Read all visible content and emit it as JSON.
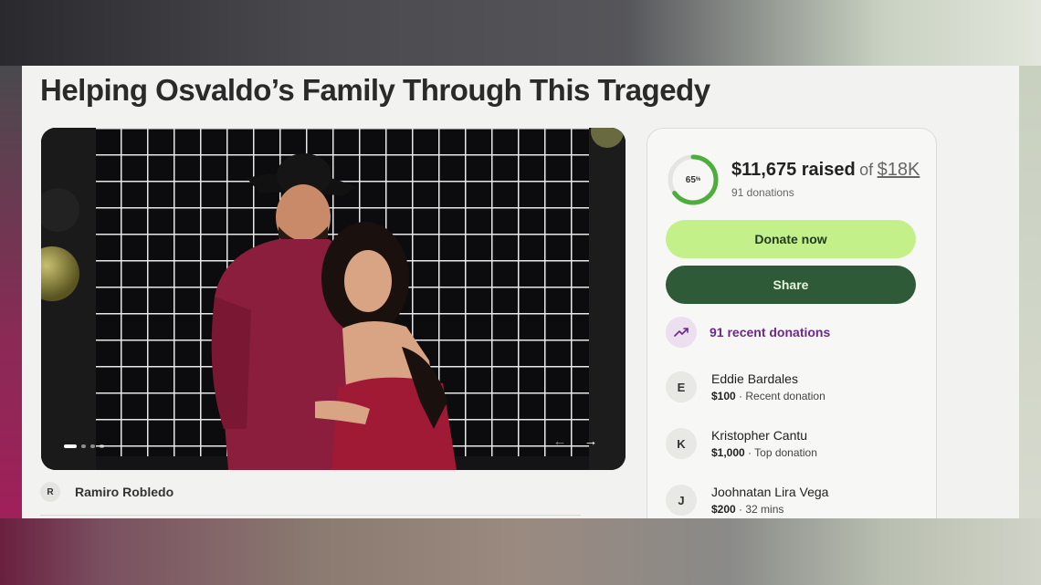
{
  "page": {
    "title": "Helping Osvaldo’s Family Through This Tragedy"
  },
  "gallery": {
    "prev_icon": "arrow-left-icon",
    "next_icon": "arrow-right-icon",
    "prev_glyph": "←",
    "next_glyph": "→"
  },
  "organizer": {
    "initial": "R",
    "name": "Ramiro Robledo"
  },
  "fundraiser": {
    "percent": 65,
    "percent_label": "65",
    "percent_suffix": "%",
    "raised": "$11,675 raised",
    "of": "of",
    "goal": "$18K",
    "donations": "91 donations",
    "accent_color": "#4caf3c"
  },
  "actions": {
    "donate": "Donate now",
    "share": "Share"
  },
  "recent": {
    "icon": "trending-up-icon",
    "label": "91 recent donations"
  },
  "donors": [
    {
      "initial": "E",
      "name": "Eddie Bardales",
      "amount": "$100",
      "sep": " · ",
      "note": "Recent donation"
    },
    {
      "initial": "K",
      "name": "Kristopher Cantu",
      "amount": "$1,000",
      "sep": " · ",
      "note": "Top donation"
    },
    {
      "initial": "J",
      "name": "Joohnatan Lira Vega",
      "amount": "$200",
      "sep": " · ",
      "note": "32 mins"
    }
  ]
}
